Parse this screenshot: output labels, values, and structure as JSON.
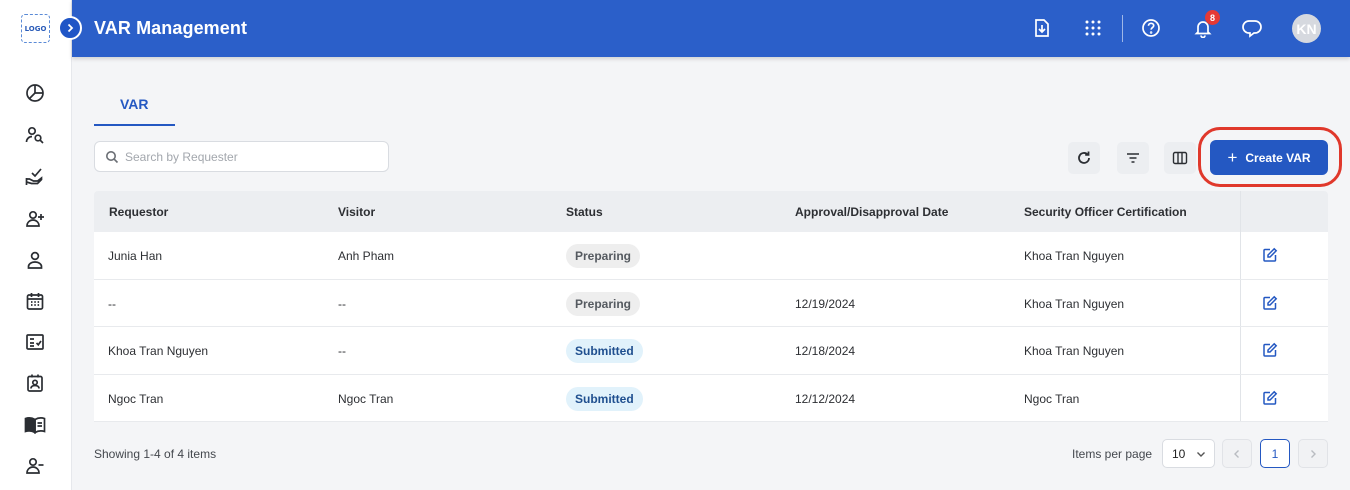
{
  "sidebar": {
    "logo_text": "LOGO",
    "items": [
      {
        "icon": "pie-chart-icon"
      },
      {
        "icon": "user-search-icon"
      },
      {
        "icon": "hand-check-icon"
      },
      {
        "icon": "user-add-icon"
      },
      {
        "icon": "user-icon"
      },
      {
        "icon": "calendar-icon"
      },
      {
        "icon": "checklist-icon"
      },
      {
        "icon": "id-card-icon"
      },
      {
        "icon": "book-icon"
      },
      {
        "icon": "user-remove-icon"
      }
    ]
  },
  "header": {
    "title": "VAR Management",
    "notification_count": "8",
    "avatar_initials": "KN"
  },
  "tabs": [
    {
      "label": "VAR",
      "active": true
    }
  ],
  "search": {
    "placeholder": "Search by Requester",
    "value": ""
  },
  "toolbar": {
    "create_label": "Create VAR"
  },
  "table": {
    "columns": [
      "Requestor",
      "Visitor",
      "Status",
      "Approval/Disapproval Date",
      "Security Officer Certification"
    ],
    "rows": [
      {
        "requestor": "Junia Han",
        "visitor": "Anh Pham",
        "status": "Preparing",
        "date": "",
        "officer": "Khoa Tran Nguyen"
      },
      {
        "requestor": "--",
        "visitor": "--",
        "status": "Preparing",
        "date": "12/19/2024",
        "officer": "Khoa Tran Nguyen"
      },
      {
        "requestor": "Khoa Tran Nguyen",
        "visitor": "--",
        "status": "Submitted",
        "date": "12/18/2024",
        "officer": "Khoa Tran Nguyen"
      },
      {
        "requestor": "Ngoc Tran",
        "visitor": "Ngoc Tran",
        "status": "Submitted",
        "date": "12/12/2024",
        "officer": "Ngoc Tran"
      }
    ]
  },
  "footer": {
    "showing": "Showing 1-4 of 4 items",
    "items_per_page_label": "Items per page",
    "items_per_page": "10",
    "current_page": "1"
  },
  "colors": {
    "header": "#2b5fc9",
    "primary": "#2458c2",
    "highlight": "#e0382b",
    "badge": "#e53935"
  }
}
